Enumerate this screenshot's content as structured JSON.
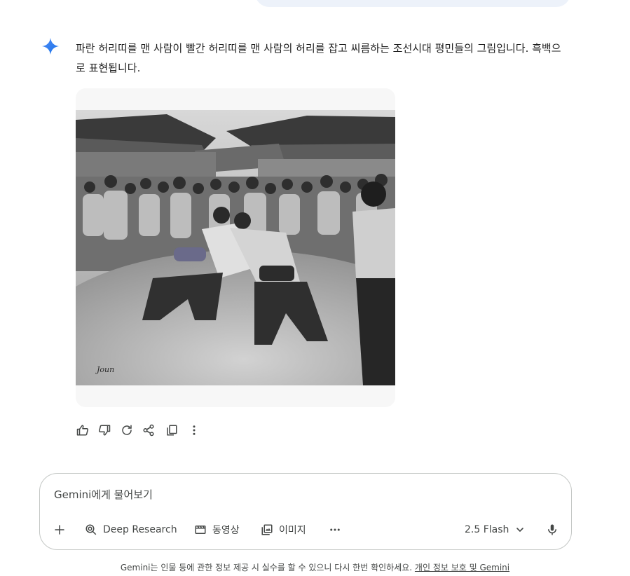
{
  "response": {
    "text": "파란 허리띠를 맨 사람이 빨간 허리띠를 맨 사람의 허리를 잡고 씨름하는 조선시대 평민들의 그림입니다. 흑백으로 표현됩니다."
  },
  "image": {
    "signature": "Joun"
  },
  "actions": [
    "thumb-up-icon",
    "thumb-down-icon",
    "refresh-icon",
    "share-icon",
    "copy-icon",
    "more-vert-icon"
  ],
  "composer": {
    "placeholder": "Gemini에게 물어보기",
    "tools": [
      {
        "label": "Deep Research",
        "icon": "deep-research-icon"
      },
      {
        "label": "동영상",
        "icon": "video-icon"
      },
      {
        "label": "이미지",
        "icon": "image-icon"
      }
    ],
    "model": "2.5 Flash"
  },
  "footer": {
    "text": "Gemini는 인물 등에 관한 정보 제공 시 실수를 할 수 있으니 다시 한번 확인하세요.",
    "link": "개인 정보 보호 및 Gemini"
  },
  "colors": {
    "accent": "#4285f4",
    "bubble": "#edf2fa",
    "border": "#c4c7c5",
    "icon": "#444746"
  }
}
